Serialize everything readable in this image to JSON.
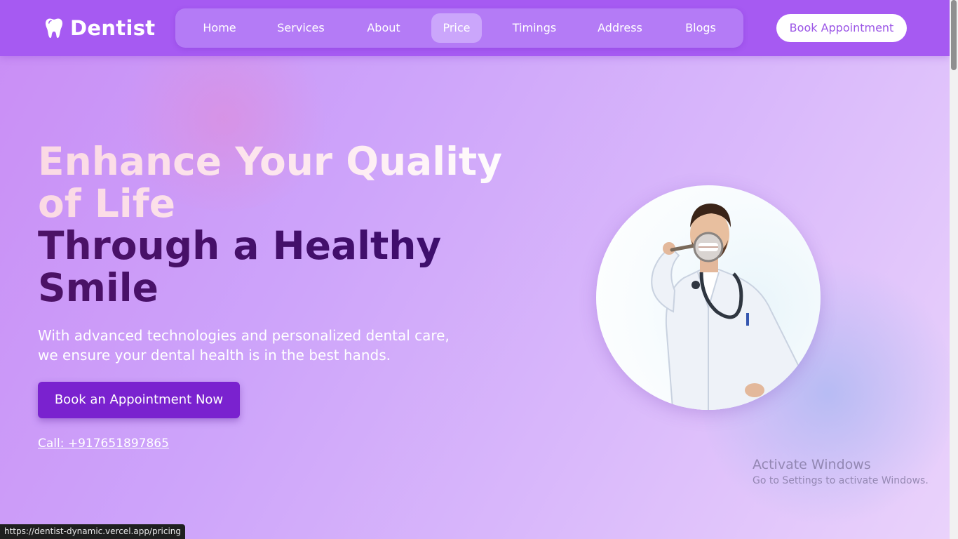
{
  "brand": {
    "name": "Dentist",
    "icon": "tooth-icon"
  },
  "nav": {
    "items": [
      {
        "label": "Home"
      },
      {
        "label": "Services"
      },
      {
        "label": "About"
      },
      {
        "label": "Price",
        "active": true
      },
      {
        "label": "Timings"
      },
      {
        "label": "Address"
      },
      {
        "label": "Blogs"
      }
    ],
    "book_label": "Book Appointment"
  },
  "hero": {
    "title_line1": "Enhance Your Quality of Life",
    "title_line2": "Through a Healthy Smile",
    "description": "With advanced technologies and personalized dental care, we ensure your dental health is in the best hands.",
    "cta_label": "Book an Appointment Now",
    "call_text": "Call: +917651897865",
    "image": "dentist-with-magnifying-glass-photo"
  },
  "watermark": {
    "title": "Activate Windows",
    "subtitle": "Go to Settings to activate Windows."
  },
  "status_bar": {
    "url": "https://dentist-dynamic.vercel.app/pricing"
  },
  "colors": {
    "header": "#a65af2",
    "nav_pill": "#b47bf6",
    "nav_active": "#cba6fb",
    "cta": "#7a22cf",
    "title_dark": "#4c1266",
    "title_light": "#fde8ef"
  }
}
